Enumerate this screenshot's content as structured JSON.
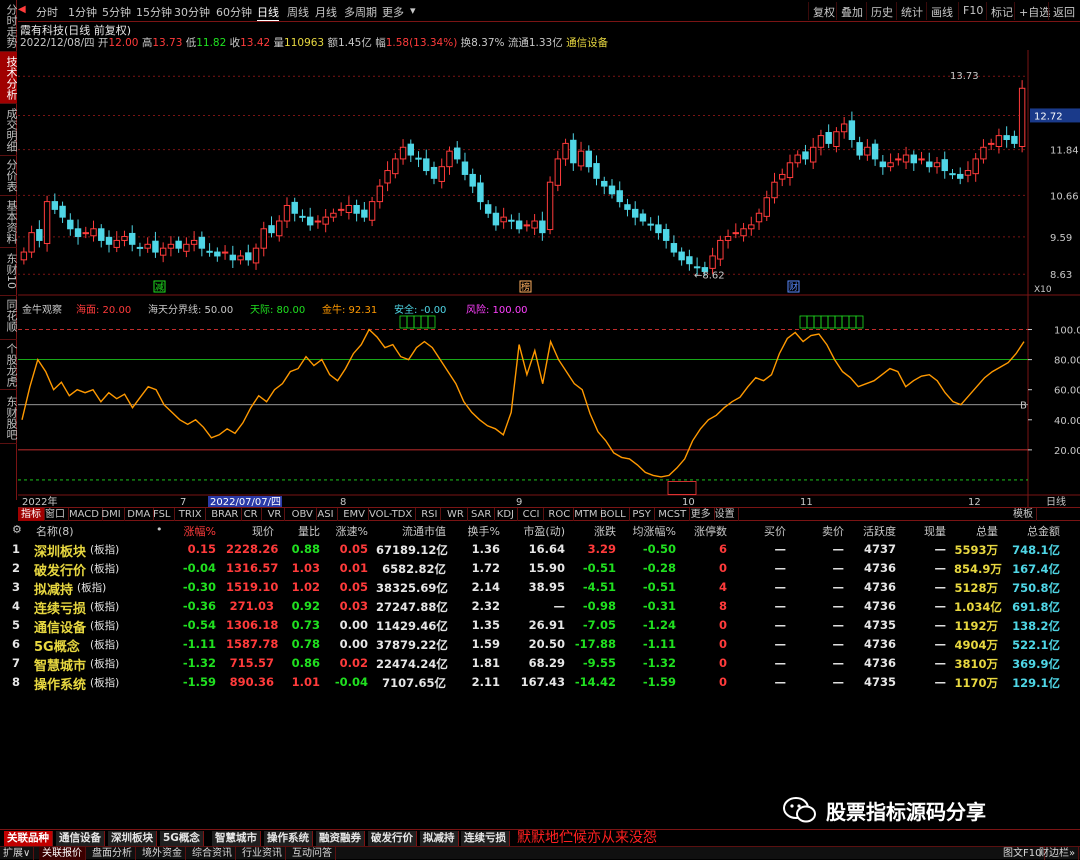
{
  "left_tabs": [
    {
      "label": "分时走势",
      "active": false
    },
    {
      "label": "技术分析",
      "active": true
    },
    {
      "label": "成交明细",
      "active": false
    },
    {
      "label": "分价表",
      "active": false
    },
    {
      "label": "基本资料",
      "active": false
    },
    {
      "label": "东财10",
      "active": false
    },
    {
      "label": "同花顺",
      "active": false
    },
    {
      "label": "个股龙虎",
      "active": false
    },
    {
      "label": "东财股吧",
      "active": false
    }
  ],
  "top_nav": {
    "left": [
      "分时",
      "1分钟",
      "5分钟",
      "15分钟",
      "30分钟",
      "60分钟",
      "日线",
      "周线",
      "月线",
      "多周期",
      "更多"
    ],
    "active": "日线",
    "right": [
      "复权",
      "叠加",
      "历史",
      "统计",
      "画线",
      "F10",
      "标记",
      "+自选",
      "返回"
    ]
  },
  "stock_info": {
    "name": "霞有科技(日线 前复权)",
    "date": "2022/12/08/四",
    "open_label": "开",
    "open": "12.00",
    "high_label": "高",
    "high": "13.73",
    "low_label": "低",
    "low": "11.82",
    "close_label": "收",
    "close": "13.42",
    "volume_label": "量",
    "volume": "110963",
    "amount": "额1.45亿",
    "change_label": "幅",
    "change": "1.58(13.34%)",
    "turnover": "换8.37%",
    "float_cap": "流通1.33亿",
    "industry": "通信设备"
  },
  "price_axis": [
    "13.73",
    "12.72",
    "11.84",
    "10.66",
    "9.59",
    "8.63"
  ],
  "price_current": "12.72",
  "kline_marks": {
    "high": "13.73",
    "low": "8.62",
    "marks": [
      "减",
      "榜",
      "财"
    ],
    "zoom": "X10"
  },
  "indicator": {
    "name": "金牛观察",
    "items": [
      {
        "label": "海面:",
        "value": "20.00",
        "color": "#ff3b3b"
      },
      {
        "label": "海天分界线:",
        "value": "50.00",
        "color": "#c8c8c8"
      },
      {
        "label": "天际:",
        "value": "80.00",
        "color": "#20e020"
      },
      {
        "label": "金牛:",
        "value": "92.31",
        "color": "#ff9900"
      },
      {
        "label": "安全:",
        "value": "-0.00",
        "color": "#4fd6e6"
      },
      {
        "label": "风险:",
        "value": "100.00",
        "color": "#ff40ff"
      }
    ],
    "axis": [
      "100.00",
      "80.00",
      "60.00",
      "40.00",
      "20.00"
    ],
    "right_label": "B"
  },
  "time_axis": {
    "labels": [
      "2022年",
      "7",
      "2022/07/07/四",
      "8",
      "9",
      "10",
      "11",
      "12"
    ],
    "right": "日线"
  },
  "indicator_tabs": {
    "items": [
      "指标",
      "窗口",
      "MACD",
      "DMI",
      "DMA",
      "FSL",
      "TRIX",
      "BRAR",
      "CR",
      "VR",
      "OBV",
      "ASI",
      "EMV",
      "VOL-TDX",
      "RSI",
      "WR",
      "SAR",
      "KDJ",
      "CCI",
      "ROC",
      "MTM",
      "BOLL",
      "PSY",
      "MCST",
      "更多",
      "设置"
    ],
    "active": "指标",
    "right": "模板"
  },
  "table": {
    "headers": [
      "名称(8)",
      "•",
      "涨幅%",
      "现价",
      "量比",
      "涨速%",
      "流通市值",
      "换手%",
      "市盈(动)",
      "涨跌",
      "均涨幅%",
      "涨停数",
      "买价",
      "卖价",
      "活跃度",
      "现量",
      "总量",
      "总金额"
    ],
    "rows": [
      {
        "idx": "1",
        "name": "深圳板块",
        "tag": "(板指)",
        "chg": "0.15",
        "price": "2228.26",
        "vr": "0.88",
        "spd": "0.05",
        "cap": "67189.12亿",
        "turn": "1.36",
        "pe": "16.64",
        "diff": "3.29",
        "avg": "-0.50",
        "limit": "6",
        "buy": "—",
        "sell": "—",
        "act": "4737",
        "cur": "—",
        "vol": "5593万",
        "amt": "748.1亿"
      },
      {
        "idx": "2",
        "name": "破发行价",
        "tag": "(板指)",
        "chg": "-0.04",
        "price": "1316.57",
        "vr": "1.03",
        "spd": "0.01",
        "cap": "6582.82亿",
        "turn": "1.72",
        "pe": "15.90",
        "diff": "-0.51",
        "avg": "-0.28",
        "limit": "0",
        "buy": "—",
        "sell": "—",
        "act": "4736",
        "cur": "—",
        "vol": "854.9万",
        "amt": "167.4亿"
      },
      {
        "idx": "3",
        "name": "拟减持",
        "tag": "(板指)",
        "chg": "-0.30",
        "price": "1519.10",
        "vr": "1.02",
        "spd": "0.05",
        "cap": "38325.69亿",
        "turn": "2.14",
        "pe": "38.95",
        "diff": "-4.51",
        "avg": "-0.51",
        "limit": "4",
        "buy": "—",
        "sell": "—",
        "act": "4736",
        "cur": "—",
        "vol": "5128万",
        "amt": "750.8亿"
      },
      {
        "idx": "4",
        "name": "连续亏损",
        "tag": "(板指)",
        "chg": "-0.36",
        "price": "271.03",
        "vr": "0.92",
        "spd": "0.03",
        "cap": "27247.88亿",
        "turn": "2.32",
        "pe": "—",
        "diff": "-0.98",
        "avg": "-0.31",
        "limit": "8",
        "buy": "—",
        "sell": "—",
        "act": "4736",
        "cur": "—",
        "vol": "1.034亿",
        "amt": "691.8亿"
      },
      {
        "idx": "5",
        "name": "通信设备",
        "tag": "(板指)",
        "chg": "-0.54",
        "price": "1306.18",
        "vr": "0.73",
        "spd": "0.00",
        "cap": "11429.46亿",
        "turn": "1.35",
        "pe": "26.91",
        "diff": "-7.05",
        "avg": "-1.24",
        "limit": "0",
        "buy": "—",
        "sell": "—",
        "act": "4735",
        "cur": "—",
        "vol": "1192万",
        "amt": "138.2亿"
      },
      {
        "idx": "6",
        "name": "5G概念",
        "tag": "(板指)",
        "chg": "-1.11",
        "price": "1587.78",
        "vr": "0.78",
        "spd": "0.00",
        "cap": "37879.22亿",
        "turn": "1.59",
        "pe": "20.50",
        "diff": "-17.88",
        "avg": "-1.11",
        "limit": "0",
        "buy": "—",
        "sell": "—",
        "act": "4736",
        "cur": "—",
        "vol": "4904万",
        "amt": "522.1亿"
      },
      {
        "idx": "7",
        "name": "智慧城市",
        "tag": "(板指)",
        "chg": "-1.32",
        "price": "715.57",
        "vr": "0.86",
        "spd": "0.02",
        "cap": "22474.24亿",
        "turn": "1.81",
        "pe": "68.29",
        "diff": "-9.55",
        "avg": "-1.32",
        "limit": "0",
        "buy": "—",
        "sell": "—",
        "act": "4736",
        "cur": "—",
        "vol": "3810万",
        "amt": "369.9亿"
      },
      {
        "idx": "8",
        "name": "操作系统",
        "tag": "(板指)",
        "chg": "-1.59",
        "price": "890.36",
        "vr": "1.01",
        "spd": "-0.04",
        "cap": "7107.65亿",
        "turn": "2.11",
        "pe": "167.43",
        "diff": "-14.42",
        "avg": "-1.59",
        "limit": "0",
        "buy": "—",
        "sell": "—",
        "act": "4735",
        "cur": "—",
        "vol": "1170万",
        "amt": "129.1亿"
      }
    ]
  },
  "watermark": "股票指标源码分享",
  "bottom_tabs": {
    "items": [
      "关联品种",
      "通信设备",
      "深圳板块",
      "5G概念",
      "智慧城市",
      "操作系统",
      "融资融券",
      "破发行价",
      "拟减持",
      "连续亏损"
    ],
    "active": "关联品种",
    "slogan": "默默地伫候亦从来没怨"
  },
  "bottom_tabs2": {
    "items": [
      "扩展∨",
      "关联报价",
      "盘面分析",
      "境外资金",
      "综合资讯",
      "行业资讯",
      "互动问答"
    ],
    "active": "关联报价",
    "right": [
      "图文F10",
      "财边栏»"
    ]
  },
  "colors": {
    "up": "#ff3b3b",
    "down": "#4fd6e6",
    "accent": "#a00000",
    "indicator_line": "#ff9900"
  }
}
